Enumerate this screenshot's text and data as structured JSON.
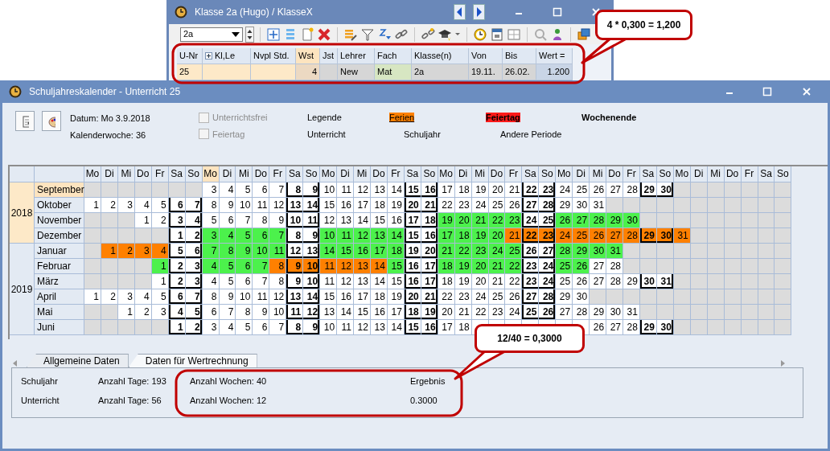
{
  "top_window": {
    "title": "Klasse 2a (Hugo) / KlasseX",
    "class_select": {
      "value": "2a"
    },
    "columns": [
      {
        "label": "U-Nr",
        "selected": false,
        "expandable": false
      },
      {
        "label": "Kl,Le",
        "selected": false,
        "expandable": true
      },
      {
        "label": "Nvpl Std.",
        "selected": false,
        "expandable": false
      },
      {
        "label": "Wst",
        "selected": true,
        "expandable": false
      },
      {
        "label": "Jst",
        "selected": false,
        "expandable": false
      },
      {
        "label": "Lehrer",
        "selected": false,
        "expandable": false
      },
      {
        "label": "Fach",
        "selected": false,
        "expandable": false
      },
      {
        "label": "Klasse(n)",
        "selected": false,
        "expandable": false
      },
      {
        "label": "Von",
        "selected": false,
        "expandable": false
      },
      {
        "label": "Bis",
        "selected": false,
        "expandable": false
      },
      {
        "label": "Wert =",
        "selected": false,
        "expandable": false
      }
    ],
    "row": [
      {
        "kind": "value",
        "text": "25"
      },
      {
        "kind": "empty"
      },
      {
        "kind": "empty"
      },
      {
        "kind": "value",
        "text": "4"
      },
      {
        "kind": "empty"
      },
      {
        "kind": "value",
        "text": "New"
      },
      {
        "kind": "value",
        "text": "Mat"
      },
      {
        "kind": "value",
        "text": "2a"
      },
      {
        "kind": "value",
        "text": "19.11."
      },
      {
        "kind": "value",
        "text": "26.02."
      },
      {
        "kind": "value",
        "text": "1.200"
      }
    ]
  },
  "callouts": [
    {
      "text": "4 * 0,300 = 1,200"
    },
    {
      "text": "12/40 = 0,3000"
    }
  ],
  "main_window": {
    "title": "Schuljahreskalender - Unterricht 25",
    "date": "Datum: Mo 3.9.2018",
    "week": "Kalenderwoche: 36",
    "checkboxes": [
      {
        "label": "Unterrichtsfrei",
        "checked": false,
        "disabled": true
      },
      {
        "label": "Feiertag",
        "checked": false,
        "disabled": true
      }
    ],
    "legend": [
      [
        {
          "label": "Legende",
          "kind": "plain"
        },
        {
          "label": "Ferien",
          "kind": "ferien"
        },
        {
          "label": "Feiertag",
          "kind": "feiertag"
        },
        {
          "label": "Wochenende",
          "kind": "weekend"
        }
      ],
      [
        {
          "label": "Unterricht",
          "kind": "plain"
        },
        {
          "label": "Schuljahr",
          "kind": "plain"
        },
        {
          "label": "Andere Periode",
          "kind": "plain"
        }
      ]
    ],
    "calendar": {
      "weekdays": [
        {
          "label": "Mo",
          "selected": false
        },
        {
          "label": "Di",
          "selected": false
        },
        {
          "label": "Mi",
          "selected": false
        },
        {
          "label": "Do",
          "selected": false
        },
        {
          "label": "Fr",
          "selected": false
        },
        {
          "label": "Sa",
          "selected": false
        },
        {
          "label": "So",
          "selected": false
        },
        {
          "label": "Mo",
          "selected": true
        },
        {
          "label": "Di",
          "selected": false
        },
        {
          "label": "Mi",
          "selected": false
        },
        {
          "label": "Do",
          "selected": false
        },
        {
          "label": "Fr",
          "selected": false
        },
        {
          "label": "Sa",
          "selected": false
        },
        {
          "label": "So",
          "selected": false
        },
        {
          "label": "Mo",
          "selected": false
        },
        {
          "label": "Di",
          "selected": false
        },
        {
          "label": "Mi",
          "selected": false
        },
        {
          "label": "Do",
          "selected": false
        },
        {
          "label": "Fr",
          "selected": false
        },
        {
          "label": "Sa",
          "selected": false
        },
        {
          "label": "So",
          "selected": false
        },
        {
          "label": "Mo",
          "selected": false
        },
        {
          "label": "Di",
          "selected": false
        },
        {
          "label": "Mi",
          "selected": false
        },
        {
          "label": "Do",
          "selected": false
        },
        {
          "label": "Fr",
          "selected": false
        },
        {
          "label": "Sa",
          "selected": false
        },
        {
          "label": "So",
          "selected": false
        },
        {
          "label": "Mo",
          "selected": false
        },
        {
          "label": "Di",
          "selected": false
        },
        {
          "label": "Mi",
          "selected": false
        },
        {
          "label": "Do",
          "selected": false
        },
        {
          "label": "Fr",
          "selected": false
        },
        {
          "label": "Sa",
          "selected": false
        },
        {
          "label": "So",
          "selected": false
        },
        {
          "label": "Mo",
          "selected": false
        },
        {
          "label": "Di",
          "selected": false
        },
        {
          "label": "Mi",
          "selected": false
        },
        {
          "label": "Do",
          "selected": false
        },
        {
          "label": "Fr",
          "selected": false
        },
        {
          "label": "Sa",
          "selected": false
        },
        {
          "label": "So",
          "selected": false
        }
      ],
      "years": [
        {
          "label": "2018",
          "selected": true,
          "months": [
            {
              "label": "September",
              "selected": true,
              "runs": [
                {
                  "kind": "blank"
                },
                {
                  "kind": "blank"
                },
                {
                  "kind": "blank"
                },
                {
                  "kind": "blank"
                },
                {
                  "kind": "blank"
                },
                {
                  "kind": "blank"
                },
                {
                  "kind": "blank"
                },
                {
                  "kind": "plain",
                  "days": [
                    "3",
                    "4",
                    "5",
                    "6",
                    "7",
                    "8",
                    "9",
                    "10",
                    "11",
                    "12",
                    "13",
                    "14",
                    "15",
                    "16",
                    "17",
                    "18",
                    "19",
                    "20",
                    "21",
                    "22",
                    "23",
                    "24",
                    "25",
                    "26",
                    "27",
                    "28",
                    "29",
                    "30"
                  ]
                }
              ]
            },
            {
              "label": "Oktober",
              "selected": false,
              "runs": [
                {
                  "kind": "plain",
                  "days": [
                    "1",
                    "2",
                    "3",
                    "4",
                    "5",
                    "6",
                    "7",
                    "8",
                    "9",
                    "10",
                    "11",
                    "12",
                    "13",
                    "14",
                    "15",
                    "16",
                    "17",
                    "18",
                    "19",
                    "20",
                    "21",
                    "22",
                    "23",
                    "24",
                    "25",
                    "26",
                    "27",
                    "28",
                    "29",
                    "30",
                    "31"
                  ]
                }
              ]
            },
            {
              "label": "November",
              "selected": false,
              "runs": [
                {
                  "kind": "blank"
                },
                {
                  "kind": "blank"
                },
                {
                  "kind": "blank"
                },
                {
                  "kind": "plain",
                  "days": [
                    "1",
                    "2",
                    "3",
                    "4",
                    "5",
                    "6",
                    "7",
                    "8",
                    "9",
                    "10",
                    "11",
                    "12",
                    "13",
                    "14",
                    "15",
                    "16",
                    "17",
                    "18"
                  ]
                },
                {
                  "kind": "lesson",
                  "days": [
                    "19",
                    "20",
                    "21",
                    "22",
                    "23"
                  ]
                },
                {
                  "kind": "plain",
                  "days": [
                    "24",
                    "25"
                  ]
                },
                {
                  "kind": "lesson",
                  "days": [
                    "26",
                    "27",
                    "28",
                    "29",
                    "30"
                  ]
                }
              ]
            },
            {
              "label": "Dezember",
              "selected": false,
              "runs": [
                {
                  "kind": "blank"
                },
                {
                  "kind": "blank"
                },
                {
                  "kind": "blank"
                },
                {
                  "kind": "blank"
                },
                {
                  "kind": "blank"
                },
                {
                  "kind": "plain",
                  "days": [
                    "1",
                    "2"
                  ]
                },
                {
                  "kind": "lesson",
                  "days": [
                    "3",
                    "4",
                    "5",
                    "6",
                    "7"
                  ]
                },
                {
                  "kind": "plain",
                  "days": [
                    "8",
                    "9"
                  ]
                },
                {
                  "kind": "lesson",
                  "days": [
                    "10",
                    "11",
                    "12",
                    "13",
                    "14"
                  ]
                },
                {
                  "kind": "plain",
                  "days": [
                    "15",
                    "16"
                  ]
                },
                {
                  "kind": "lesson",
                  "days": [
                    "17",
                    "18",
                    "19",
                    "20"
                  ]
                },
                {
                  "kind": "holiday",
                  "days": [
                    "21",
                    "22",
                    "23",
                    "24",
                    "25",
                    "26",
                    "27",
                    "28",
                    "29",
                    "30",
                    "31"
                  ]
                }
              ]
            }
          ]
        },
        {
          "label": "2019",
          "selected": false,
          "months": [
            {
              "label": "Januar",
              "selected": false,
              "runs": [
                {
                  "kind": "blank"
                },
                {
                  "kind": "holiday",
                  "days": [
                    "1",
                    "2",
                    "3",
                    "4"
                  ]
                },
                {
                  "kind": "plain",
                  "days": [
                    "5",
                    "6"
                  ]
                },
                {
                  "kind": "lesson",
                  "days": [
                    "7",
                    "8",
                    "9",
                    "10",
                    "11"
                  ]
                },
                {
                  "kind": "plain",
                  "days": [
                    "12",
                    "13"
                  ]
                },
                {
                  "kind": "lesson",
                  "days": [
                    "14",
                    "15",
                    "16",
                    "17",
                    "18"
                  ]
                },
                {
                  "kind": "plain",
                  "days": [
                    "19",
                    "20"
                  ]
                },
                {
                  "kind": "lesson",
                  "days": [
                    "21",
                    "22",
                    "23",
                    "24",
                    "25"
                  ]
                },
                {
                  "kind": "plain",
                  "days": [
                    "26",
                    "27"
                  ]
                },
                {
                  "kind": "lesson",
                  "days": [
                    "28",
                    "29",
                    "30",
                    "31"
                  ]
                }
              ]
            },
            {
              "label": "Februar",
              "selected": false,
              "runs": [
                {
                  "kind": "blank"
                },
                {
                  "kind": "blank"
                },
                {
                  "kind": "blank"
                },
                {
                  "kind": "blank"
                },
                {
                  "kind": "lesson",
                  "days": [
                    "1"
                  ]
                },
                {
                  "kind": "plain",
                  "days": [
                    "2",
                    "3"
                  ]
                },
                {
                  "kind": "lesson",
                  "days": [
                    "4",
                    "5",
                    "6",
                    "7"
                  ]
                },
                {
                  "kind": "holiday",
                  "days": [
                    "8",
                    "9",
                    "10",
                    "11",
                    "12",
                    "13",
                    "14"
                  ]
                },
                {
                  "kind": "lesson",
                  "days": [
                    "15"
                  ]
                },
                {
                  "kind": "plain",
                  "days": [
                    "16",
                    "17"
                  ]
                },
                {
                  "kind": "lesson",
                  "days": [
                    "18",
                    "19",
                    "20",
                    "21",
                    "22"
                  ]
                },
                {
                  "kind": "plain",
                  "days": [
                    "23",
                    "24"
                  ]
                },
                {
                  "kind": "lesson",
                  "days": [
                    "25",
                    "26"
                  ]
                },
                {
                  "kind": "plain",
                  "days": [
                    "27",
                    "28"
                  ]
                }
              ]
            },
            {
              "label": "März",
              "selected": false,
              "runs": [
                {
                  "kind": "blank"
                },
                {
                  "kind": "blank"
                },
                {
                  "kind": "blank"
                },
                {
                  "kind": "blank"
                },
                {
                  "kind": "plain",
                  "days": [
                    "1",
                    "2",
                    "3",
                    "4",
                    "5",
                    "6",
                    "7",
                    "8",
                    "9",
                    "10",
                    "11",
                    "12",
                    "13",
                    "14",
                    "15",
                    "16",
                    "17",
                    "18",
                    "19",
                    "20",
                    "21",
                    "22",
                    "23",
                    "24",
                    "25",
                    "26",
                    "27",
                    "28",
                    "29",
                    "30",
                    "31"
                  ]
                }
              ]
            },
            {
              "label": "April",
              "selected": false,
              "runs": [
                {
                  "kind": "plain",
                  "days": [
                    "1",
                    "2",
                    "3",
                    "4",
                    "5",
                    "6",
                    "7",
                    "8",
                    "9",
                    "10",
                    "11",
                    "12",
                    "13",
                    "14",
                    "15",
                    "16",
                    "17",
                    "18",
                    "19",
                    "20",
                    "21",
                    "22",
                    "23",
                    "24",
                    "25",
                    "26",
                    "27",
                    "28",
                    "29",
                    "30"
                  ]
                }
              ]
            },
            {
              "label": "Mai",
              "selected": false,
              "runs": [
                {
                  "kind": "blank"
                },
                {
                  "kind": "blank"
                },
                {
                  "kind": "plain",
                  "days": [
                    "1",
                    "2",
                    "3",
                    "4",
                    "5",
                    "6",
                    "7",
                    "8",
                    "9",
                    "10",
                    "11",
                    "12",
                    "13",
                    "14",
                    "15",
                    "16",
                    "17",
                    "18",
                    "19",
                    "20",
                    "21",
                    "22",
                    "23",
                    "24",
                    "25",
                    "26",
                    "27",
                    "28",
                    "29",
                    "30",
                    "31"
                  ]
                }
              ]
            },
            {
              "label": "Juni",
              "selected": false,
              "runs": [
                {
                  "kind": "blank"
                },
                {
                  "kind": "blank"
                },
                {
                  "kind": "blank"
                },
                {
                  "kind": "blank"
                },
                {
                  "kind": "blank"
                },
                {
                  "kind": "plain",
                  "days": [
                    "1",
                    "2",
                    "3",
                    "4",
                    "5",
                    "6",
                    "7",
                    "8",
                    "9",
                    "10",
                    "11",
                    "12",
                    "13",
                    "14",
                    "15",
                    "16",
                    "17",
                    "18"
                  ]
                },
                {
                  "kind": "covered"
                },
                {
                  "kind": "covered"
                },
                {
                  "kind": "covered"
                },
                {
                  "kind": "covered"
                },
                {
                  "kind": "covered"
                },
                {
                  "kind": "covered"
                },
                {
                  "kind": "covered"
                },
                {
                  "kind": "plain",
                  "days": [
                    "26",
                    "27",
                    "28",
                    "29",
                    "30"
                  ]
                }
              ]
            }
          ]
        }
      ]
    },
    "tabs": [
      {
        "label": "Allgemeine Daten",
        "selected": false
      },
      {
        "label": "Daten für Wertrechnung",
        "selected": true
      }
    ],
    "stats": [
      [
        "Schuljahr",
        "Anzahl Tage: 193",
        "Anzahl Wochen: 40",
        "Ergebnis"
      ],
      [
        "Unterricht",
        "Anzahl Tage: 56",
        "Anzahl Wochen: 12",
        "0.3000"
      ]
    ]
  }
}
